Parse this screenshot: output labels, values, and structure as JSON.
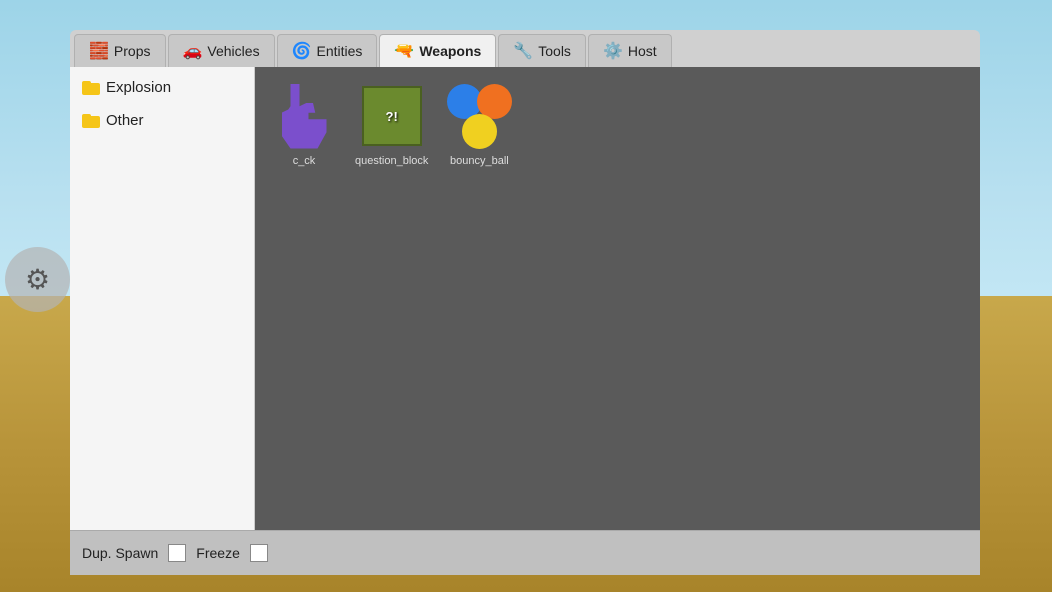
{
  "background": {
    "sky_color": "#9DD4E8",
    "ground_color": "#C8A84B"
  },
  "tabs": [
    {
      "id": "props",
      "label": "Props",
      "icon": "🧱",
      "active": false
    },
    {
      "id": "vehicles",
      "label": "Vehicles",
      "icon": "🚗",
      "active": false
    },
    {
      "id": "entities",
      "label": "Entities",
      "icon": "🌀",
      "active": false
    },
    {
      "id": "weapons",
      "label": "Weapons",
      "icon": "🔫",
      "active": true
    },
    {
      "id": "tools",
      "label": "Tools",
      "icon": "🔧",
      "active": false
    },
    {
      "id": "host",
      "label": "Host",
      "icon": "⚙️",
      "active": false
    }
  ],
  "sidebar": {
    "items": [
      {
        "id": "explosion",
        "label": "Explosion"
      },
      {
        "id": "other",
        "label": "Other"
      }
    ]
  },
  "items": [
    {
      "id": "c_ck",
      "label": "c_ck",
      "type": "shape_cck"
    },
    {
      "id": "question_block",
      "label": "question_block",
      "type": "shape_qblock"
    },
    {
      "id": "bouncy_ball",
      "label": "bouncy_ball",
      "type": "shape_bball"
    }
  ],
  "bottom_bar": {
    "dup_spawn_label": "Dup. Spawn",
    "freeze_label": "Freeze"
  }
}
